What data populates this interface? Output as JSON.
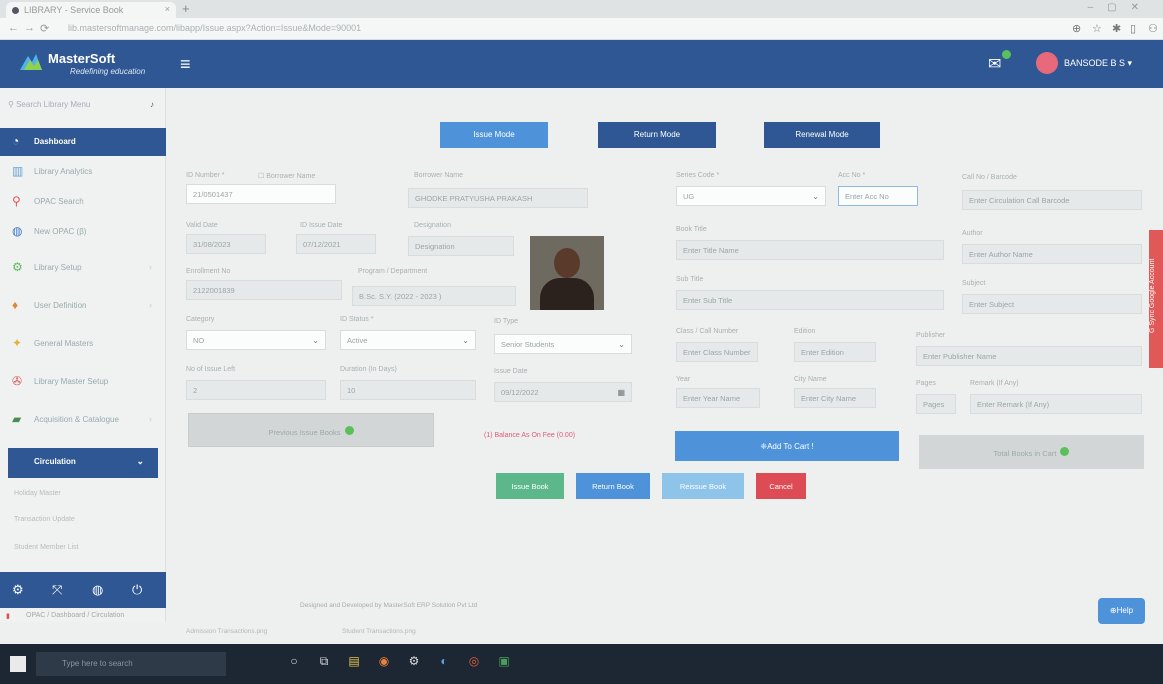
{
  "browser": {
    "tab_title": "LIBRARY - Service Book",
    "url": "lib.mastersoftmanage.com/libapp/Issue.aspx?Action=Issue&Mode=90001"
  },
  "sidebar": {
    "brand_name": "MasterSoft",
    "brand_tagline": "Redefining education",
    "search_placeholder": "Search Library Menu",
    "items": [
      {
        "label": "Dashboard",
        "icon": "speedometer-icon"
      },
      {
        "label": "Library Analytics",
        "icon": "chart-icon"
      },
      {
        "label": "OPAC Search",
        "icon": "search-icon"
      },
      {
        "label": "New OPAC (β)",
        "icon": "globe-icon"
      },
      {
        "label": "Library Setup",
        "icon": "gear-icon"
      },
      {
        "label": "User Definition",
        "icon": "user-icon"
      },
      {
        "label": "General Masters",
        "icon": "star-icon"
      },
      {
        "label": "Library Master Setup",
        "icon": "wrench-icon"
      },
      {
        "label": "Acquisition & Catalogue",
        "icon": "book-icon"
      },
      {
        "label": "Circulation",
        "icon": "circulation-icon"
      }
    ],
    "sub_items": [
      "Holiday Master",
      "Transaction Update",
      "Student Member List"
    ],
    "opac_item": "OPAC / Dashboard / Circulation"
  },
  "header": {
    "user_name": "BANSODE B S ▾"
  },
  "modes": {
    "issue": "Issue Mode",
    "return": "Return Mode",
    "renewal": "Renewal Mode"
  },
  "form": {
    "id_number_label": "ID Number *",
    "borrower_name_label": "Borrower Name",
    "id_number": "21/0501437",
    "borrower_name_field_label": "Borrower Name",
    "borrower_name": "GHODKE PRATYUSHA PRAKASH",
    "valid_date_label": "Valid Date",
    "valid_date": "31/08/2023",
    "id_issue_date_label": "ID Issue Date",
    "id_issue_date": "07/12/2021",
    "designation_label": "Designation",
    "designation_placeholder": "Designation",
    "enrollment_label": "Enrollment No",
    "enrollment_no": "2122001839",
    "program_label": "Program / Department",
    "program": "B.Sc. S.Y. (2022 - 2023 )",
    "category_label": "Category",
    "category": "NO",
    "id_status_label": "ID Status *",
    "id_status": "Active",
    "id_type_label": "ID Type",
    "id_type": "Senior Students",
    "books_left_label": "No of Issue Left",
    "books_left": "2",
    "duration_label": "Duration (In Days)",
    "duration": "10",
    "issue_date_label": "Issue Date",
    "issue_date": "09/12/2022",
    "series_code_label": "Series Code *",
    "series_code": "UG",
    "acc_no_label": "Acc No *",
    "acc_no_placeholder": "Enter Acc No",
    "call_no_label": "Call No / Barcode",
    "call_no_placeholder": "Enter Circulation Call Barcode",
    "book_title_label": "Book Title",
    "book_title_placeholder": "Enter Title Name",
    "author_label": "Author",
    "author_placeholder": "Enter Author Name",
    "sub_title_label": "Sub Title",
    "sub_title_placeholder": "Enter Sub Title",
    "subject_label": "Subject",
    "subject_placeholder": "Enter Subject",
    "class_no_label": "Class / Call Number",
    "class_no_placeholder": "Enter Class Number",
    "edition_label": "Edition",
    "edition_placeholder": "Enter Edition",
    "publisher_label": "Publisher",
    "publisher_placeholder": "Enter Publisher Name",
    "year_label": "Year",
    "year_placeholder": "Enter Year Name",
    "city_label": "City Name",
    "city_placeholder": "Enter City Name",
    "pages_label": "Pages",
    "pages_placeholder": "Pages",
    "remark_label": "Remark (If Any)",
    "remark_placeholder": "Enter Remark (If Any)"
  },
  "buttons": {
    "previous_issue": "Previous Issue Books",
    "balance_text": "(1) Balance As On Fee (0.00)",
    "add_to_cart": "❈Add To Cart !",
    "total_books": "Total Books in Cart",
    "issue_book": "Issue Book",
    "return_book": "Return Book",
    "reissue_book": "Reissue Book",
    "cancel": "Cancel",
    "help": "⊕Help"
  },
  "sync_label": "G Sync Google Account",
  "footer": "Designed and Developed by MasterSoft ERP Solution Pvt Ltd",
  "downloads": [
    "Admission Transactions.png",
    "Student Transactions.png"
  ],
  "taskbar": {
    "search_placeholder": "Type here to search"
  },
  "colors": {
    "brand": "#2f5794",
    "issue_green": "#5cb88a",
    "action_blue": "#4e93d9",
    "cancel_red": "#dd4c54"
  }
}
